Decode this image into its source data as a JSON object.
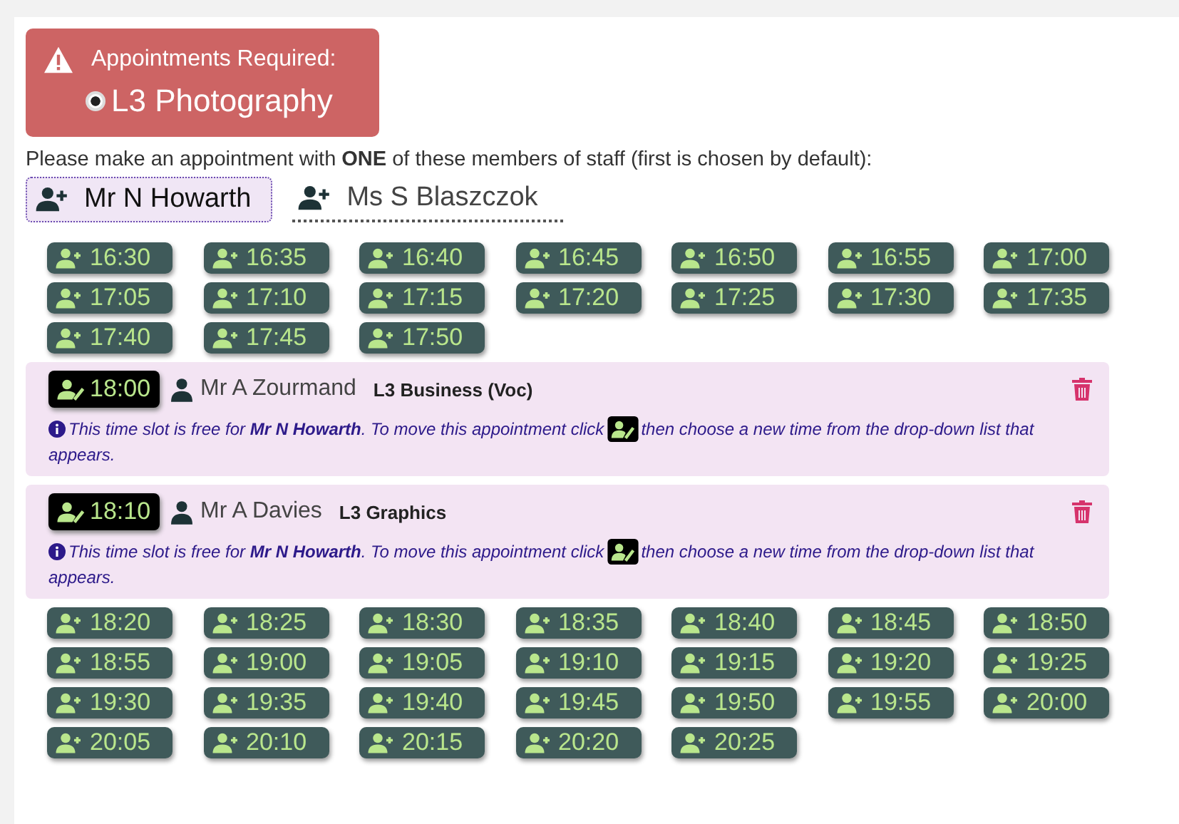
{
  "alert": {
    "title": "Appointments Required:",
    "subject": "L3 Photography",
    "subject_selected": true
  },
  "instruction": "Please make an appointment with **ONE** of these members of staff (first is chosen by default):",
  "staff_tabs": [
    {
      "label": "Mr N Howarth",
      "selected": true
    },
    {
      "label": "Ms S Blaszczok",
      "selected": false
    }
  ],
  "slots": [
    {
      "kind": "free",
      "time": "16:30"
    },
    {
      "kind": "free",
      "time": "16:35"
    },
    {
      "kind": "free",
      "time": "16:40"
    },
    {
      "kind": "free",
      "time": "16:45"
    },
    {
      "kind": "free",
      "time": "16:50"
    },
    {
      "kind": "free",
      "time": "16:55"
    },
    {
      "kind": "free",
      "time": "17:00"
    },
    {
      "kind": "free",
      "time": "17:05"
    },
    {
      "kind": "free",
      "time": "17:10"
    },
    {
      "kind": "free",
      "time": "17:15"
    },
    {
      "kind": "free",
      "time": "17:20"
    },
    {
      "kind": "free",
      "time": "17:25"
    },
    {
      "kind": "free",
      "time": "17:30"
    },
    {
      "kind": "free",
      "time": "17:35"
    },
    {
      "kind": "free",
      "time": "17:40"
    },
    {
      "kind": "free",
      "time": "17:45"
    },
    {
      "kind": "free",
      "time": "17:50"
    },
    {
      "kind": "booked",
      "time": "18:00",
      "student": "Mr A Zourmand",
      "course": "L3 Business (Voc)",
      "note_before": "This time slot is free for **Mr N Howarth**. To move this appointment click",
      "note_after": "then choose a new time from the drop-down list that",
      "note_wrap": "appears."
    },
    {
      "kind": "booked",
      "time": "18:10",
      "student": "Mr A Davies",
      "course": "L3 Graphics",
      "note_before": "This time slot is free for **Mr N Howarth**. To move this appointment click",
      "note_after": "then choose a new time from the drop-down list that",
      "note_wrap": "appears."
    },
    {
      "kind": "free",
      "time": "18:20"
    },
    {
      "kind": "free",
      "time": "18:25"
    },
    {
      "kind": "free",
      "time": "18:30"
    },
    {
      "kind": "free",
      "time": "18:35"
    },
    {
      "kind": "free",
      "time": "18:40"
    },
    {
      "kind": "free",
      "time": "18:45"
    },
    {
      "kind": "free",
      "time": "18:50"
    },
    {
      "kind": "free",
      "time": "18:55"
    },
    {
      "kind": "free",
      "time": "19:00"
    },
    {
      "kind": "free",
      "time": "19:05"
    },
    {
      "kind": "free",
      "time": "19:10"
    },
    {
      "kind": "free",
      "time": "19:15"
    },
    {
      "kind": "free",
      "time": "19:20"
    },
    {
      "kind": "free",
      "time": "19:25"
    },
    {
      "kind": "free",
      "time": "19:30"
    },
    {
      "kind": "free",
      "time": "19:35"
    },
    {
      "kind": "free",
      "time": "19:40"
    },
    {
      "kind": "free",
      "time": "19:45"
    },
    {
      "kind": "free",
      "time": "19:50"
    },
    {
      "kind": "free",
      "time": "19:55"
    },
    {
      "kind": "free",
      "time": "20:00"
    },
    {
      "kind": "free",
      "time": "20:05"
    },
    {
      "kind": "free",
      "time": "20:10"
    },
    {
      "kind": "free",
      "time": "20:15"
    },
    {
      "kind": "free",
      "time": "20:20"
    },
    {
      "kind": "free",
      "time": "20:25"
    }
  ]
}
